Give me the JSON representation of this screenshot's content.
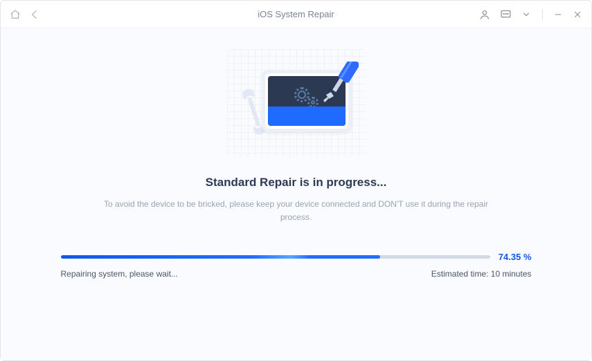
{
  "titlebar": {
    "title": "iOS System Repair"
  },
  "main": {
    "heading": "Standard Repair is in progress...",
    "subtext": "To avoid the device to be bricked, please keep your device connected and DON'T use it during the repair process."
  },
  "progress": {
    "percent_label": "74.35 %",
    "percent_value": 74.35,
    "status": "Repairing system, please wait...",
    "estimated_time": "Estimated time: 10 minutes"
  }
}
